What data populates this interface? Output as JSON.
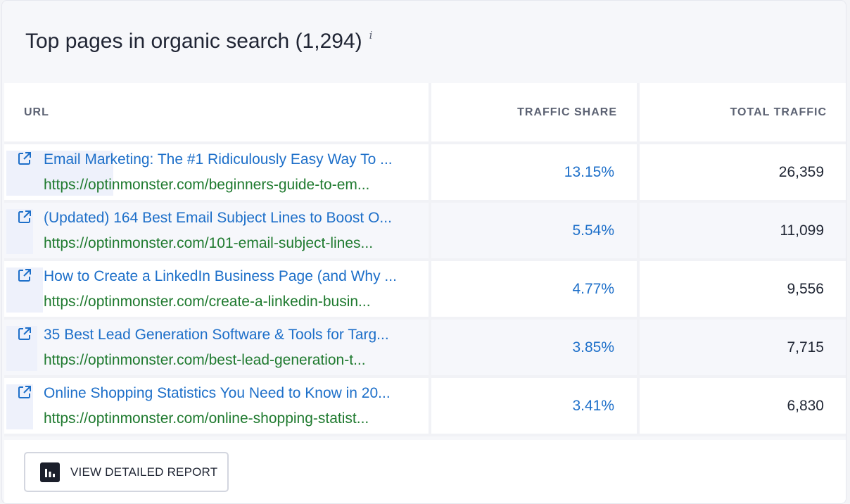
{
  "header": {
    "title": "Top pages in organic search (1,294)",
    "info_symbol": "i"
  },
  "table": {
    "columns": {
      "url": "URL",
      "share": "TRAFFIC SHARE",
      "total": "TOTAL TRAFFIC"
    },
    "rows": [
      {
        "title": "Email Marketing: The #1 Ridiculously Easy Way To ...",
        "url": "https://optinmonster.com/beginners-guide-to-em...",
        "share": "13.15%",
        "total": "26,359"
      },
      {
        "title": "(Updated) 164 Best Email Subject Lines to Boost O...",
        "url": "https://optinmonster.com/101-email-subject-lines...",
        "share": "5.54%",
        "total": "11,099"
      },
      {
        "title": "How to Create a LinkedIn Business Page (and Why ...",
        "url": "https://optinmonster.com/create-a-linkedin-busin...",
        "share": "4.77%",
        "total": "9,556"
      },
      {
        "title": "35 Best Lead Generation Software & Tools for Targ...",
        "url": "https://optinmonster.com/best-lead-generation-t...",
        "share": "3.85%",
        "total": "7,715"
      },
      {
        "title": "Online Shopping Statistics You Need to Know in 20...",
        "url": "https://optinmonster.com/online-shopping-statist...",
        "share": "3.41%",
        "total": "6,830"
      }
    ]
  },
  "footer": {
    "report_button_label": "VIEW DETAILED REPORT",
    "report_icon": "bar-chart-icon"
  },
  "colors": {
    "link_blue": "#1d6fc9",
    "url_green": "#1f7a2f",
    "text_dark": "#1f2533",
    "header_gray": "#5c6273"
  }
}
